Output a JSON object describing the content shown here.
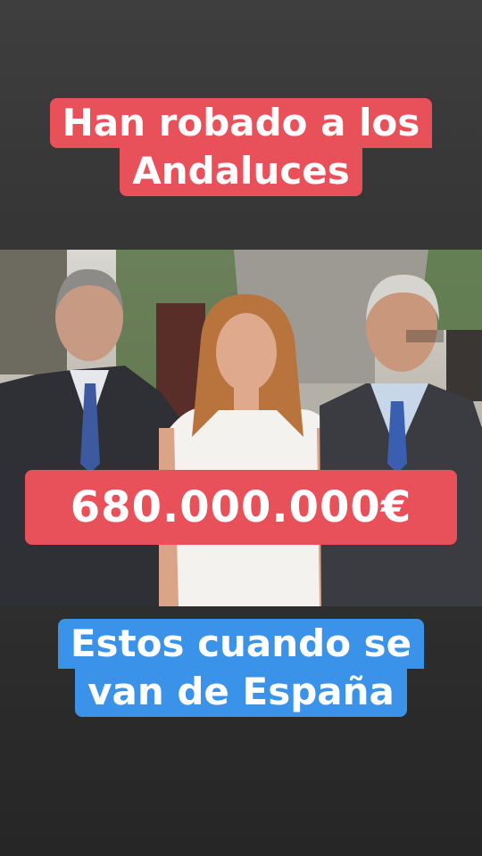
{
  "top_caption": {
    "line1": "Han robado a los",
    "line2": "Andaluces",
    "color": "#e8505a"
  },
  "amount_badge": {
    "text": "680.000.000€",
    "color": "#e8505a"
  },
  "bottom_caption": {
    "line1": "Estos cuando se",
    "line2": "van de España",
    "color": "#3a93e8"
  },
  "background_color": "#333333"
}
